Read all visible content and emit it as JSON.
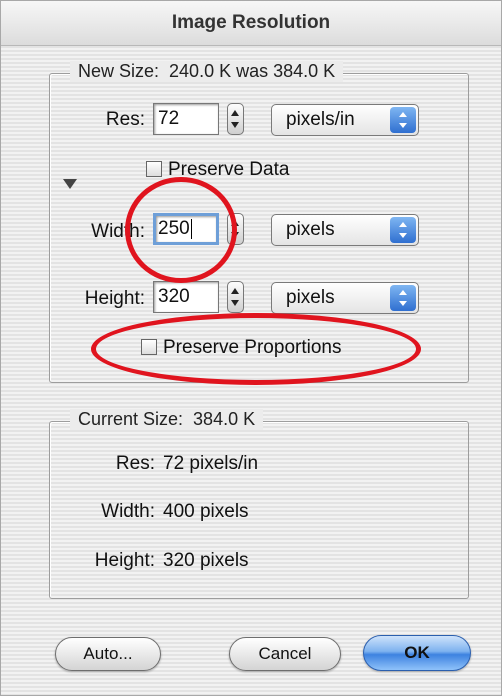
{
  "window": {
    "title": "Image Resolution"
  },
  "new_size": {
    "legend_label": "New Size:",
    "legend_value": "240.0 K was 384.0 K",
    "res_label": "Res:",
    "res_value": "72",
    "res_unit": "pixels/in",
    "preserve_data_label": "Preserve Data",
    "width_label": "Width:",
    "width_value": "250",
    "width_unit": "pixels",
    "height_label": "Height:",
    "height_value": "320",
    "height_unit": "pixels",
    "preserve_proportions_label": "Preserve Proportions"
  },
  "current_size": {
    "legend_label": "Current Size:",
    "legend_value": "384.0 K",
    "res_label": "Res:",
    "res_value": "72 pixels/in",
    "width_label": "Width:",
    "width_value": "400 pixels",
    "height_label": "Height:",
    "height_value": "320 pixels"
  },
  "buttons": {
    "auto": "Auto...",
    "cancel": "Cancel",
    "ok": "OK"
  },
  "colors": {
    "annotation": "#e0141e",
    "accent": "#3d82e0"
  }
}
